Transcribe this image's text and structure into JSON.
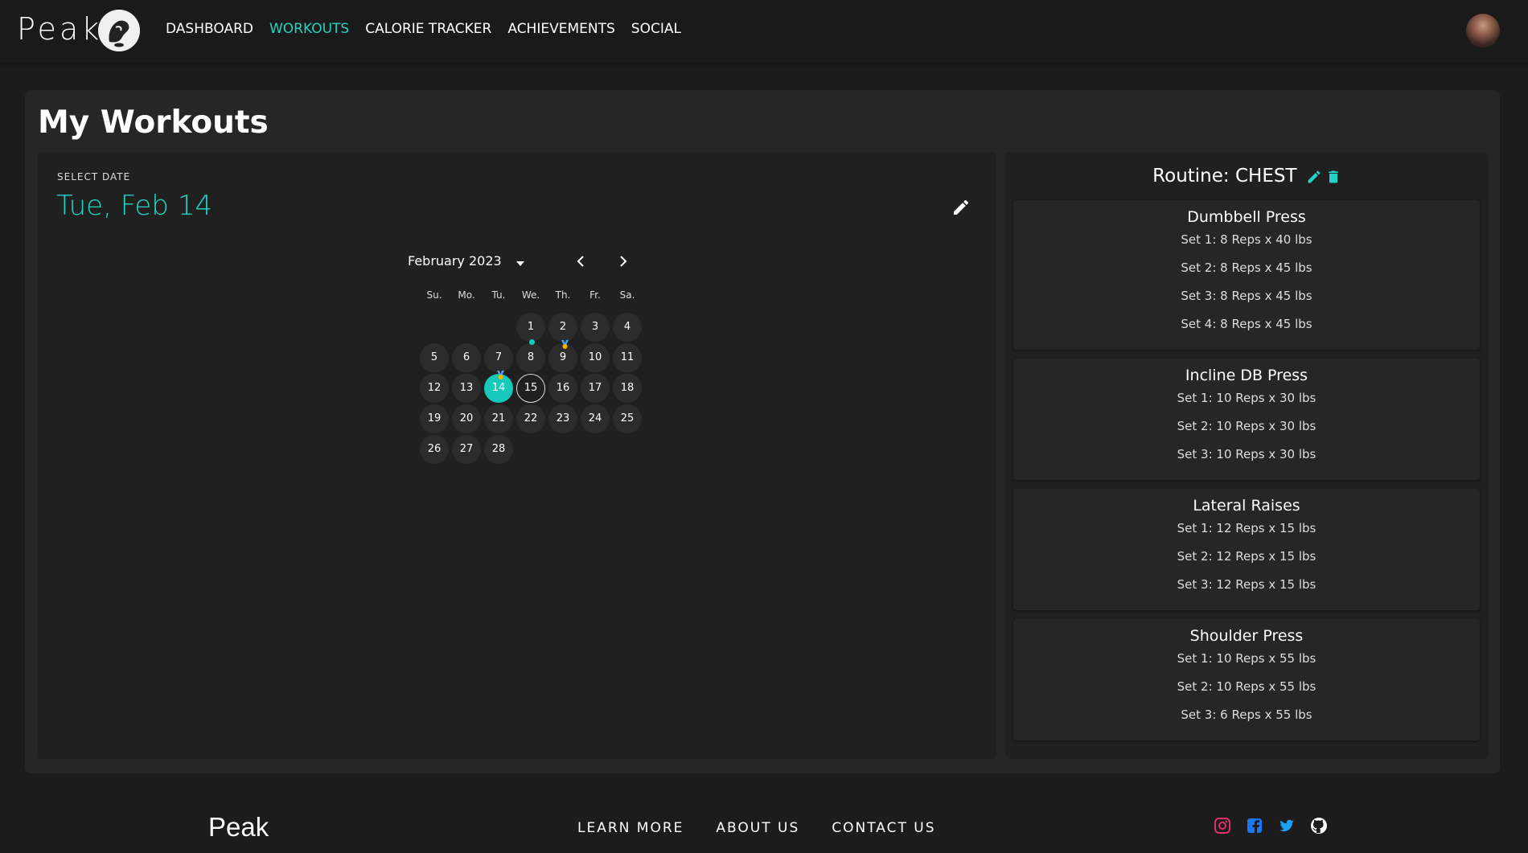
{
  "header": {
    "brand": "Peak",
    "nav": [
      {
        "label": "DASHBOARD",
        "active": false
      },
      {
        "label": "WORKOUTS",
        "active": true
      },
      {
        "label": "CALORIE TRACKER",
        "active": false
      },
      {
        "label": "ACHIEVEMENTS",
        "active": false
      },
      {
        "label": "SOCIAL",
        "active": false
      }
    ]
  },
  "page": {
    "title": "My Workouts"
  },
  "calendar": {
    "select_label": "SELECT DATE",
    "selected_date": "Tue, Feb 14",
    "month_label": "February 2023",
    "weekdays": [
      "Su.",
      "Mo.",
      "Tu.",
      "We.",
      "Th.",
      "Fr.",
      "Sa."
    ],
    "days": [
      "1",
      "2",
      "3",
      "4",
      "5",
      "6",
      "7",
      "8",
      "9",
      "10",
      "11",
      "12",
      "13",
      "14",
      "15",
      "16",
      "17",
      "18",
      "19",
      "20",
      "21",
      "22",
      "23",
      "24",
      "25",
      "26",
      "27",
      "28"
    ],
    "first_weekday_index": 3,
    "selected_day": "14",
    "today_day": "15",
    "dot_days": [
      "8"
    ],
    "medal_days": [
      "9",
      "14"
    ]
  },
  "routine": {
    "prefix": "Routine: ",
    "name": "CHEST",
    "exercises": [
      {
        "name": "Dumbbell Press",
        "sets": [
          "Set 1: 8 Reps x 40 lbs",
          "Set 2: 8 Reps x 45 lbs",
          "Set 3: 8 Reps x 45 lbs",
          "Set 4: 8 Reps x 45 lbs"
        ]
      },
      {
        "name": "Incline DB Press",
        "sets": [
          "Set 1: 10 Reps x 30 lbs",
          "Set 2: 10 Reps x 30 lbs",
          "Set 3: 10 Reps x 30 lbs"
        ]
      },
      {
        "name": "Lateral Raises",
        "sets": [
          "Set 1: 12 Reps x 15 lbs",
          "Set 2: 12 Reps x 15 lbs",
          "Set 3: 12 Reps x 15 lbs"
        ]
      },
      {
        "name": "Shoulder Press",
        "sets": [
          "Set 1: 10 Reps x 55 lbs",
          "Set 2: 10 Reps x 55 lbs",
          "Set 3: 6 Reps x 55 lbs"
        ]
      }
    ]
  },
  "footer": {
    "brand": "Peak",
    "links": [
      "LEARN MORE",
      "ABOUT US",
      "CONTACT US"
    ],
    "icons": [
      "instagram-icon",
      "facebook-icon",
      "twitter-icon",
      "github-icon"
    ]
  },
  "colors": {
    "accent": "#22d3c5",
    "background": "#1c1c1c",
    "panel": "#262626",
    "card": "#202020"
  }
}
